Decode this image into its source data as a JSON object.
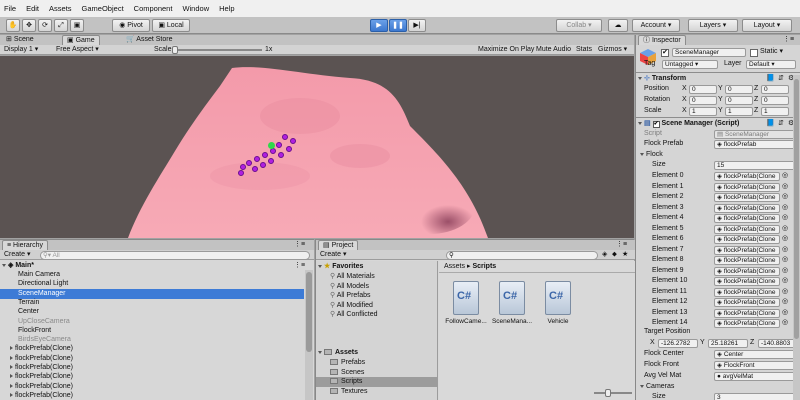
{
  "menu": [
    "File",
    "Edit",
    "Assets",
    "GameObject",
    "Component",
    "Window",
    "Help"
  ],
  "toolbar": {
    "pivot": "Pivot",
    "local": "Local",
    "collab": "Collab ▾",
    "account": "Account",
    "layers": "Layers",
    "layout": "Layout"
  },
  "scene_tabs": {
    "scene": "Scene",
    "game": "Game",
    "asset_store": "Asset Store"
  },
  "game_bar": {
    "display": "Display 1",
    "aspect": "Free Aspect",
    "scale_label": "Scale",
    "scale_value": "1x",
    "maximize": "Maximize On Play",
    "mute": "Mute Audio",
    "stats": "Stats",
    "gizmos": "Gizmos"
  },
  "hierarchy": {
    "tab": "Hierarchy",
    "create": "Create",
    "search_placeholder": "All",
    "scene": "Main*",
    "items": [
      {
        "label": "Main Camera",
        "type": "normal"
      },
      {
        "label": "Directional Light",
        "type": "normal"
      },
      {
        "label": "SceneManager",
        "type": "selected"
      },
      {
        "label": "Terrain",
        "type": "normal"
      },
      {
        "label": "Center",
        "type": "normal"
      },
      {
        "label": "UpCloseCamera",
        "type": "disabled"
      },
      {
        "label": "FlockFront",
        "type": "normal"
      },
      {
        "label": "BirdsEyeCamera",
        "type": "disabled"
      },
      {
        "label": "flockPrefab(Clone)",
        "type": "prefab"
      },
      {
        "label": "flockPrefab(Clone)",
        "type": "prefab"
      },
      {
        "label": "flockPrefab(Clone)",
        "type": "prefab"
      },
      {
        "label": "flockPrefab(Clone)",
        "type": "prefab"
      },
      {
        "label": "flockPrefab(Clone)",
        "type": "prefab"
      },
      {
        "label": "flockPrefab(Clone)",
        "type": "prefab"
      }
    ]
  },
  "project": {
    "tab": "Project",
    "create": "Create",
    "favorites": "Favorites",
    "favorite_items": [
      "All Materials",
      "All Models",
      "All Prefabs",
      "All Modified",
      "All Conflicted"
    ],
    "assets": "Assets",
    "asset_folders": [
      "Prefabs",
      "Scenes",
      "Scripts",
      "Textures"
    ],
    "breadcrumb_root": "Assets",
    "breadcrumb_sep": "▸",
    "breadcrumb_current": "Scripts",
    "files": [
      "FollowCame...",
      "SceneMana...",
      "Vehicle"
    ]
  },
  "inspector": {
    "tab": "Inspector",
    "object_name": "SceneManager",
    "static_label": "Static",
    "tag_label": "Tag",
    "tag_value": "Untagged",
    "layer_label": "Layer",
    "layer_value": "Default",
    "transform": {
      "title": "Transform",
      "rows": [
        {
          "label": "Position",
          "x": "0",
          "y": "0",
          "z": "0"
        },
        {
          "label": "Rotation",
          "x": "0",
          "y": "0",
          "z": "0"
        },
        {
          "label": "Scale",
          "x": "1",
          "y": "1",
          "z": "1"
        }
      ]
    },
    "script_component": {
      "title": "Scene Manager (Script)",
      "script_label": "Script",
      "script_value": "SceneManager",
      "flock_prefab_label": "Flock Prefab",
      "flock_prefab_value": "flockPrefab",
      "flock_label": "Flock",
      "size_label": "Size",
      "size_value": "15",
      "elements": [
        "Element 0",
        "Element 1",
        "Element 2",
        "Element 3",
        "Element 4",
        "Element 5",
        "Element 6",
        "Element 7",
        "Element 8",
        "Element 9",
        "Element 10",
        "Element 11",
        "Element 12",
        "Element 13",
        "Element 14"
      ],
      "element_value": "flockPrefab(Clone",
      "target_position_label": "Target Position",
      "target": {
        "x": "-126.2782",
        "y": "25.18261",
        "z": "-140.8803"
      },
      "flock_center_label": "Flock Center",
      "flock_center_value": "Center",
      "flock_front_label": "Flock Front",
      "flock_front_value": "FlockFront",
      "avg_vel_label": "Avg Vel Mat",
      "avg_vel_value": "avgVelMat",
      "cameras_label": "Cameras",
      "cameras_size_label": "Size",
      "cameras_size_value": "3"
    }
  },
  "colors": {
    "terrain": "#f5a3b0",
    "game_bg": "#5b5352",
    "selected": "#3d7bd6",
    "boid": "#b01fe0"
  }
}
